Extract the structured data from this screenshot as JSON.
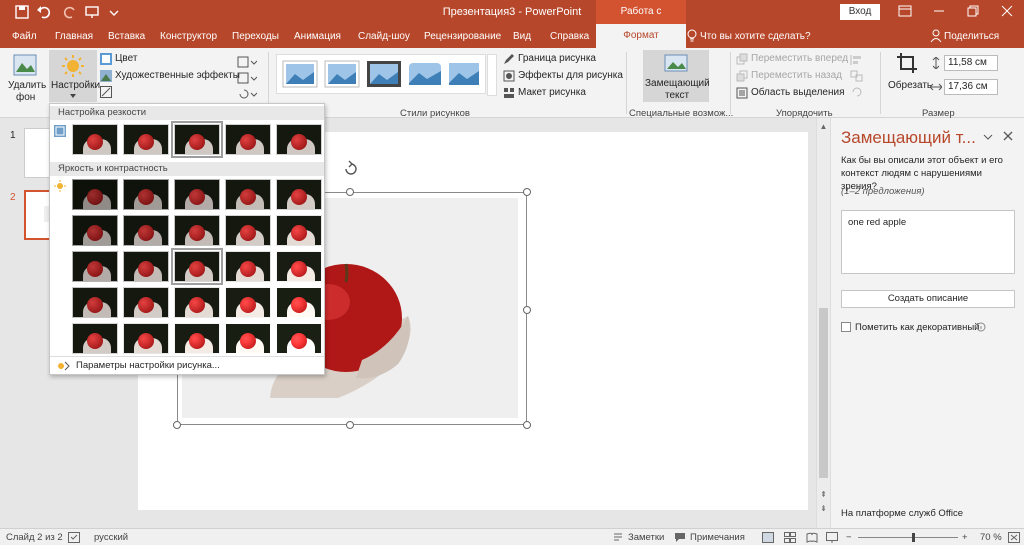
{
  "titlebar": {
    "title": "Презентация3  -  PowerPoint",
    "context_group": "Работа с рисунками",
    "login": "Вход"
  },
  "tabs": [
    "Файл",
    "Главная",
    "Вставка",
    "Конструктор",
    "Переходы",
    "Анимация",
    "Слайд-шоу",
    "Рецензирование",
    "Вид",
    "Справка"
  ],
  "active_tab": "Формат",
  "tell_me": "Что вы хотите сделать?",
  "share": "Поделиться",
  "ribbon": {
    "remove_bg_line1": "Удалить",
    "remove_bg_line2": "фон",
    "corrections": "Настройки",
    "color": "Цвет",
    "artistic": "Художественные эффекты",
    "border": "Граница рисунка",
    "effects": "Эффекты для рисунка",
    "layout": "Макет рисунка",
    "styles_group": "Стили рисунков",
    "alt_text_line1": "Замещающий",
    "alt_text_line2": "текст",
    "special_group": "Специальные возмож...",
    "bring_forward": "Переместить вперед",
    "send_backward": "Переместить назад",
    "selection_pane": "Область выделения",
    "arrange_group": "Упорядочить",
    "crop": "Обрезать",
    "height": "11,58 см",
    "width": "17,36 см",
    "size_group": "Размер"
  },
  "gallery": {
    "sharpness_header": "Настройка резкости",
    "brightness_header": "Яркость и контрастность",
    "options": "Параметры настройки рисунка...",
    "sharpness_thumbs": 5,
    "brightness_rows": 5,
    "brightness_cols": 5
  },
  "slides": [
    "1",
    "2"
  ],
  "pane": {
    "title": "Замещающий т...",
    "question": "Как бы вы описали этот объект и его контекст людям с нарушениями зрения?",
    "hint": "(1–2 предложения)",
    "alt_text_value": "one red apple",
    "generate_button": "Создать описание",
    "decorative_label": "Пометить как декоративный",
    "footer": "На платформе служб Office"
  },
  "status": {
    "slide": "Слайд 2 из 2",
    "language": "русский",
    "notes": "Заметки",
    "comments": "Примечания",
    "zoom": "70 %"
  },
  "colors": {
    "accent": "#b7472a",
    "context": "#d35230"
  }
}
